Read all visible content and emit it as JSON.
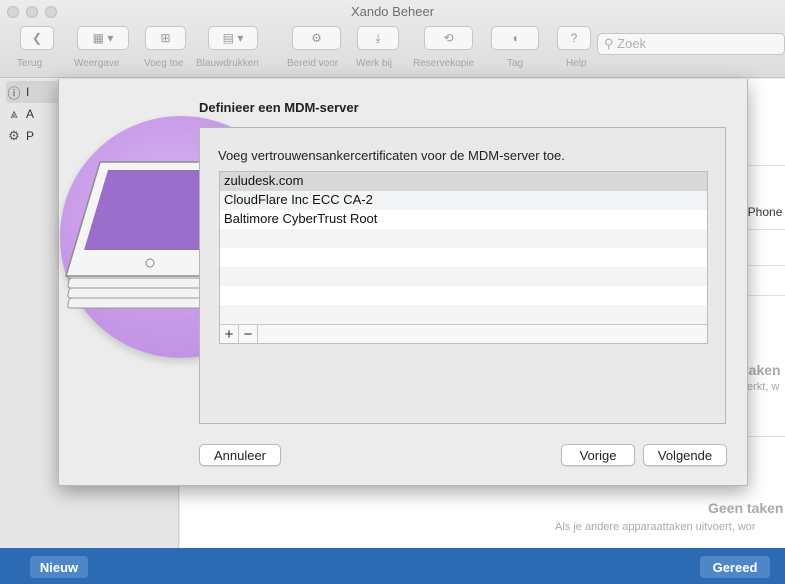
{
  "window": {
    "title": "Xando Beheer"
  },
  "toolbar": {
    "labels": [
      "Terug",
      "Weergave",
      "Voeg toe",
      "Blauwdrukken",
      "Bereid voor",
      "Werk bij",
      "Reservekopie",
      "Tag",
      "Help"
    ],
    "search_placeholder": "Zoek"
  },
  "sidebar": {
    "items": [
      {
        "icon": "info-icon",
        "label": "I"
      },
      {
        "icon": "apps-icon",
        "label": "A"
      },
      {
        "icon": "gear-icon",
        "label": "P"
      }
    ]
  },
  "background": {
    "iphone_text": "iPhone",
    "taken_title_1": "taken",
    "taken_sub_1": "erkt, w",
    "geen_taken": "Geen taken",
    "geen_taken_sub": "Als je andere apparaattaken uitvoert, wor"
  },
  "sheet": {
    "title": "Definieer een MDM-server",
    "heading": "Voeg vertrouwensankercertificaten voor de MDM-server toe.",
    "certificates": [
      "zuludesk.com",
      "CloudFlare Inc ECC CA-2",
      "Baltimore CyberTrust Root"
    ],
    "add_symbol": "+",
    "remove_symbol": "−",
    "cancel_label": "Annuleer",
    "back_label": "Vorige",
    "next_label": "Volgende"
  },
  "bottom": {
    "new_label": "Nieuw",
    "done_label": "Gereed"
  }
}
